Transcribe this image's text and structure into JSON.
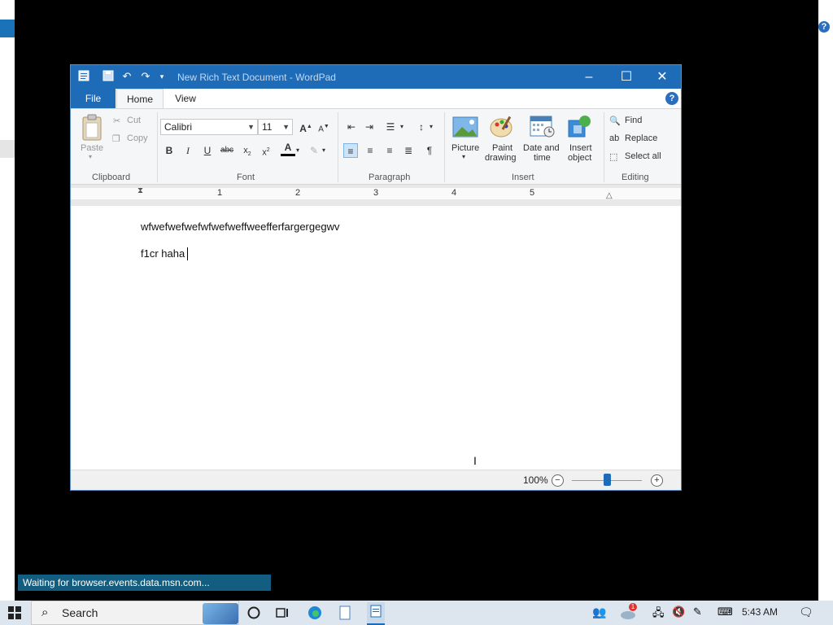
{
  "window": {
    "title": "New Rich Text Document - WordPad",
    "controls": {
      "minimize": "–",
      "maximize": "☐",
      "close": "✕"
    }
  },
  "ribbon_tabs": {
    "file": "File",
    "home": "Home",
    "view": "View"
  },
  "clipboard": {
    "paste": "Paste",
    "cut": "Cut",
    "copy": "Copy",
    "label": "Clipboard"
  },
  "font": {
    "family": "Calibri",
    "size": "11",
    "label": "Font"
  },
  "paragraph": {
    "label": "Paragraph"
  },
  "insert": {
    "picture": "Picture",
    "paint_1": "Paint",
    "paint_2": "drawing",
    "date_1": "Date and",
    "date_2": "time",
    "object_1": "Insert",
    "object_2": "object",
    "label": "Insert"
  },
  "editing": {
    "find": "Find",
    "replace": "Replace",
    "select_all": "Select all",
    "label": "Editing"
  },
  "ruler": {
    "marks": [
      "1",
      "2",
      "3",
      "4",
      "5"
    ]
  },
  "document": {
    "line1": "wfwefwefwefwfwefweffweefferfargergegwv",
    "line2": "f1cr haha"
  },
  "status": {
    "zoom": "100%",
    "zoom_level": 0.5
  },
  "browser_status": "Waiting for browser.events.data.msn.com...",
  "taskbar": {
    "search": "Search",
    "time": "5:43 AM",
    "notification_badge": "1"
  },
  "colors": {
    "accent": "#1e6bb8",
    "status_bar": "#135e80"
  }
}
